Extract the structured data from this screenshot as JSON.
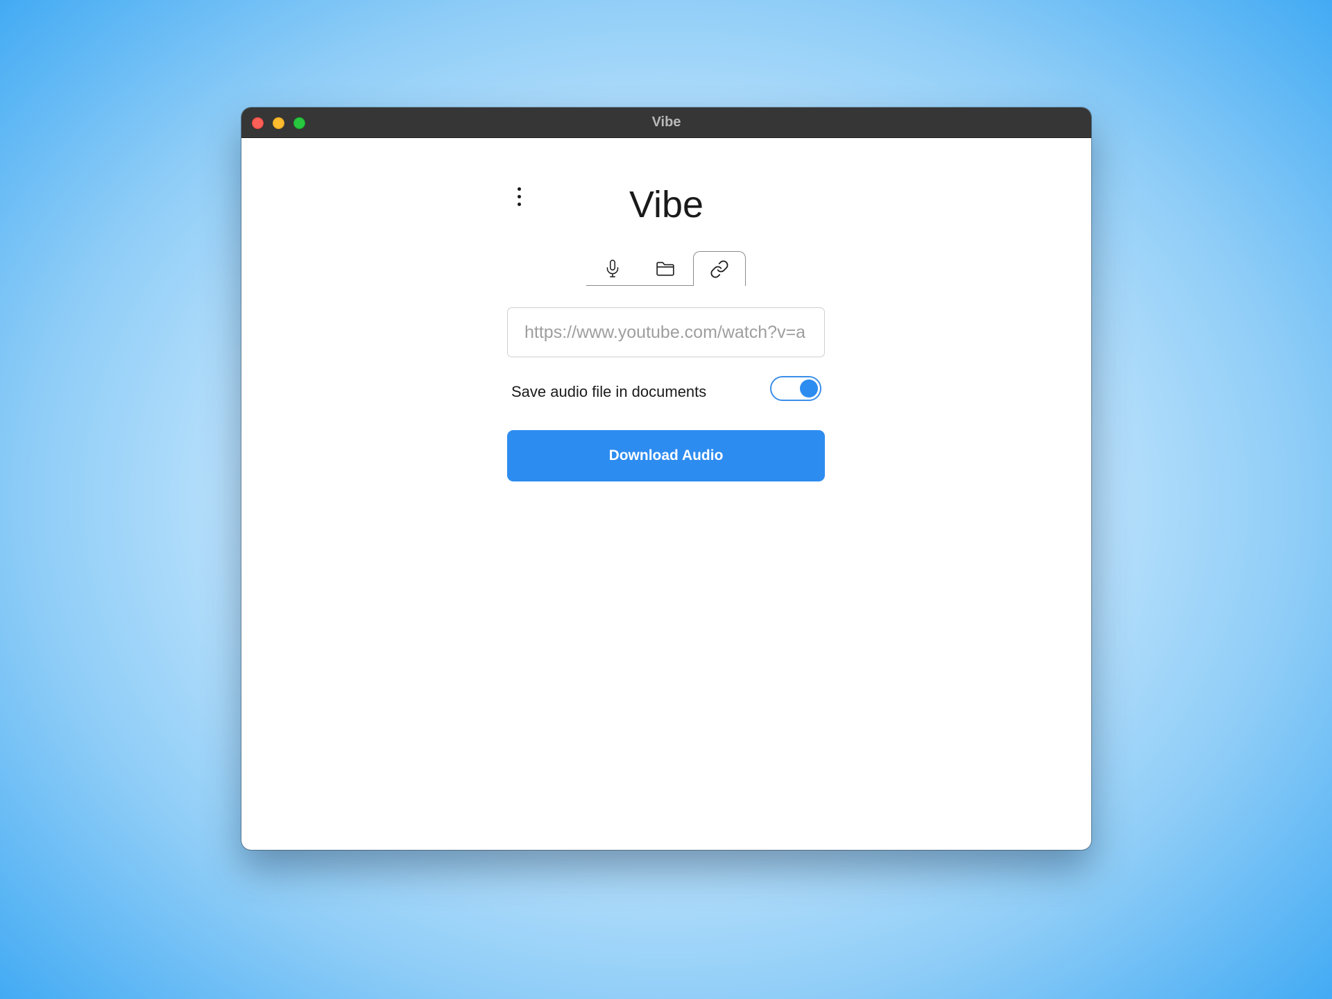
{
  "window": {
    "title": "Vibe"
  },
  "app": {
    "title": "Vibe",
    "menu_icon": "more-vertical-icon"
  },
  "tabs": [
    {
      "icon": "microphone-icon",
      "active": false
    },
    {
      "icon": "folder-icon",
      "active": false
    },
    {
      "icon": "link-icon",
      "active": true
    }
  ],
  "url_input": {
    "value": "",
    "placeholder": "https://www.youtube.com/watch?v=a"
  },
  "save_option": {
    "label": "Save audio file in documents",
    "enabled": true
  },
  "download_button": {
    "label": "Download Audio"
  },
  "colors": {
    "accent": "#2d8cf0",
    "titlebar": "#363636",
    "traffic_close": "#fe5f57",
    "traffic_minimize": "#febc2e",
    "traffic_zoom": "#28c840"
  }
}
